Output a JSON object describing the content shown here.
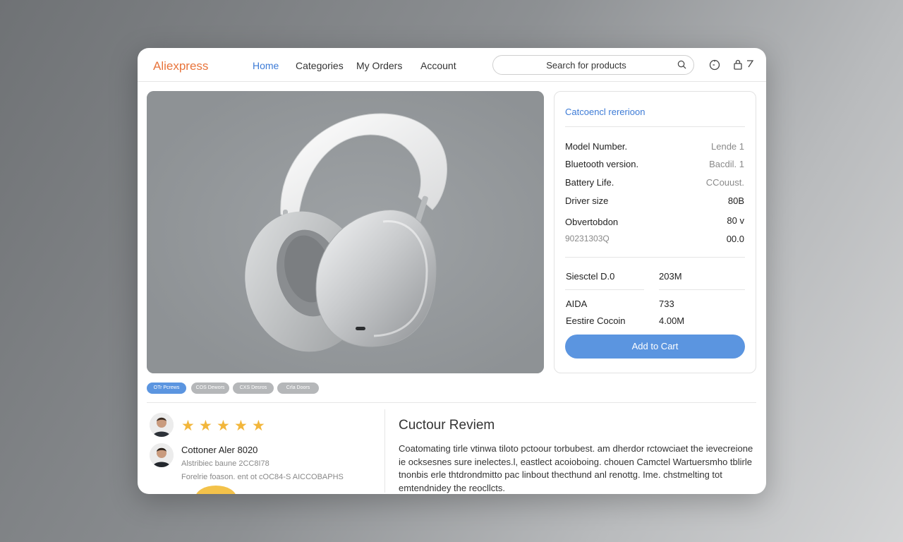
{
  "header": {
    "logo": "Aliexpress",
    "nav": [
      "Home",
      "Categories",
      "My Orders",
      "Account"
    ],
    "search_placeholder": "Search for products"
  },
  "spec": {
    "title": "Catcoencl rererioon",
    "rows": [
      {
        "label": "Model Number.",
        "value": "Lende  1"
      },
      {
        "label": "Bluetooth version.",
        "value": "Bacdil. 1"
      },
      {
        "label": "Battery Life.",
        "value": "CCouust."
      },
      {
        "label": "Driver size",
        "value": "80B"
      },
      {
        "label": "Obvertobdon",
        "value": "80 v"
      },
      {
        "label": "90231303Q",
        "value": "00.0"
      }
    ],
    "price_rows": [
      {
        "label": "Siesctel D.0",
        "value": "203M"
      },
      {
        "label": "AIDA",
        "value": "733"
      },
      {
        "label": "Eestire Cocoin",
        "value": "4.00M"
      }
    ],
    "add_to_cart": "Add to Cart"
  },
  "pills": [
    "OTr Pcrews",
    "COS Dewors",
    "CXS Desros",
    "Crla Doors"
  ],
  "review": {
    "stars": 5,
    "name": "Cottoner Aler 8020",
    "meta1": "Alstribiec baune 2CC8I78",
    "meta2": "Forelrie foason. ent ot cOC84-S AICCOBAPHS",
    "title": "Cuctour Reviem",
    "body": "Coatomating tirle vtinwa tiloto pctoour torbubest. am dherdor rctowciaet the ievecreione ie ocksesnes sure inelectes.l, eastlect acoioboing. chouen Camctel Wartuersmho tblirle tnonbis erle thtdrondmitto pac linbout thecthund anl renottg. Ime. chstmelting tot emtendnidey the reocllcts."
  },
  "colors": {
    "accent": "#3d7bd6",
    "brand": "#e8743b",
    "button": "#5b95e0",
    "star": "#f2b63b"
  }
}
